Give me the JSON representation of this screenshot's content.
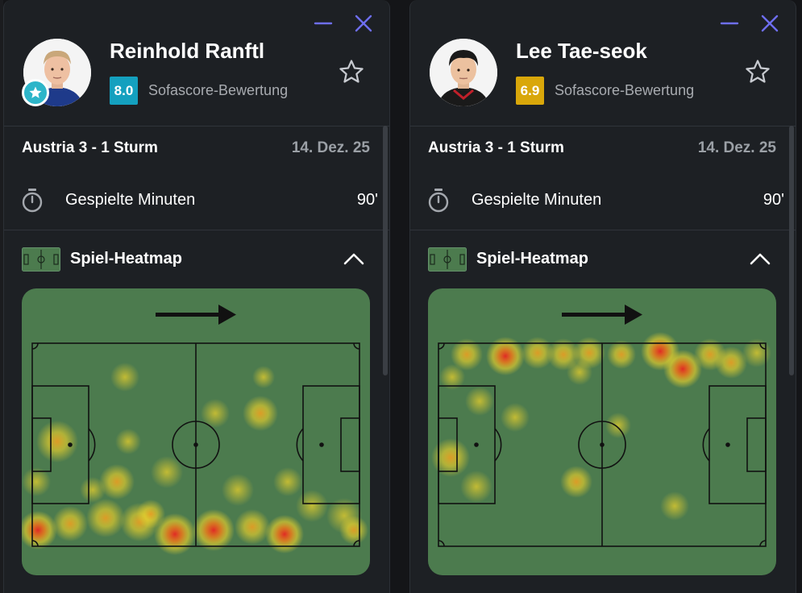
{
  "players": [
    {
      "name": "Reinhold Ranftl",
      "rating": "8.0",
      "rating_color": "#14a0bf",
      "rating_label": "Sofascore-Bewertung",
      "star_badge": true,
      "match": {
        "title": "Austria 3 - 1 Sturm",
        "date": "14. Dez. 25"
      },
      "minutes_label": "Gespielte Minuten",
      "minutes_value": "90'",
      "heatmap_title": "Spiel-Heatmap",
      "icons": [
        "minimize-icon",
        "close-icon",
        "favorite-star-icon",
        "stopwatch-icon",
        "pitch-icon",
        "chevron-up-icon",
        "direction-arrow-icon"
      ]
    },
    {
      "name": "Lee Tae-seok",
      "rating": "6.9",
      "rating_color": "#d9a70a",
      "rating_label": "Sofascore-Bewertung",
      "star_badge": false,
      "match": {
        "title": "Austria 3 - 1 Sturm",
        "date": "14. Dez. 25"
      },
      "minutes_label": "Gespielte Minuten",
      "minutes_value": "90'",
      "heatmap_title": "Spiel-Heatmap",
      "icons": [
        "minimize-icon",
        "close-icon",
        "favorite-star-icon",
        "stopwatch-icon",
        "pitch-icon",
        "chevron-up-icon",
        "direction-arrow-icon"
      ]
    }
  ],
  "colors": {
    "accent": "#6e6ef0",
    "card_bg": "#1d2024",
    "pitch": "#4c7b4e"
  }
}
